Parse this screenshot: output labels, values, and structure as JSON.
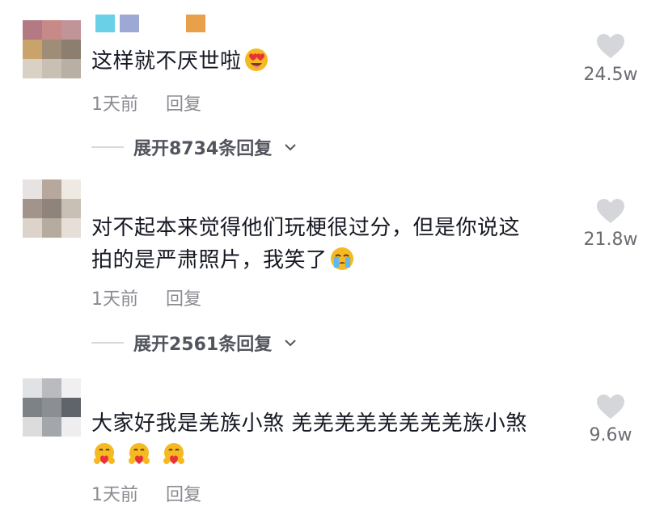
{
  "comments": [
    {
      "text": "这样就不厌世啦",
      "time": "1天前",
      "reply_label": "回复",
      "expand_label": "展开8734条回复",
      "likes": "24.5w",
      "emoji_names": [
        "heart-eyes-emoji"
      ],
      "avatar_colors": [
        "#b37a84",
        "#c88a88",
        "#c09498",
        "#c9a36a",
        "#9f8d77",
        "#8d7f70",
        "#d9d2c4",
        "#c9c0b3",
        "#b8afa5"
      ],
      "name_colors": [
        "#6ad0e8",
        "#9ea8d5",
        "#e9a04b"
      ]
    },
    {
      "text_line1": "对不起本来觉得他们玩梗很过分，但是你说这",
      "text_line2": "拍的是严肃照片，我笑了",
      "time": "1天前",
      "reply_label": "回复",
      "expand_label": "展开2561条回复",
      "likes": "21.8w",
      "emoji_names": [
        "crying-emoji"
      ],
      "avatar_colors": [
        "#e7e3e2",
        "#b7a89d",
        "#efe9e4",
        "#a3948b",
        "#8f847b",
        "#c8bfb5",
        "#dcd4cb",
        "#b6ab9f",
        "#e6dfd8"
      ]
    },
    {
      "text": "大家好我是羌族小煞 羌羌羌羌羌羌羌羌族小煞",
      "time": "1天前",
      "reply_label": "回复",
      "likes": "9.6w",
      "emoji_names": [
        "hug-emoji",
        "hug-emoji",
        "hug-emoji"
      ],
      "avatar_colors": [
        "#e1e2e4",
        "#b9bbbe",
        "#f0f0f1",
        "#7d8287",
        "#8b8f94",
        "#5f646a",
        "#dcdcdc",
        "#a3a6aa",
        "#eeeeee"
      ]
    }
  ],
  "colors": {
    "text": "#161823",
    "meta": "#8a8b91",
    "expand": "#53555e",
    "heart": "#d5d6d9"
  }
}
